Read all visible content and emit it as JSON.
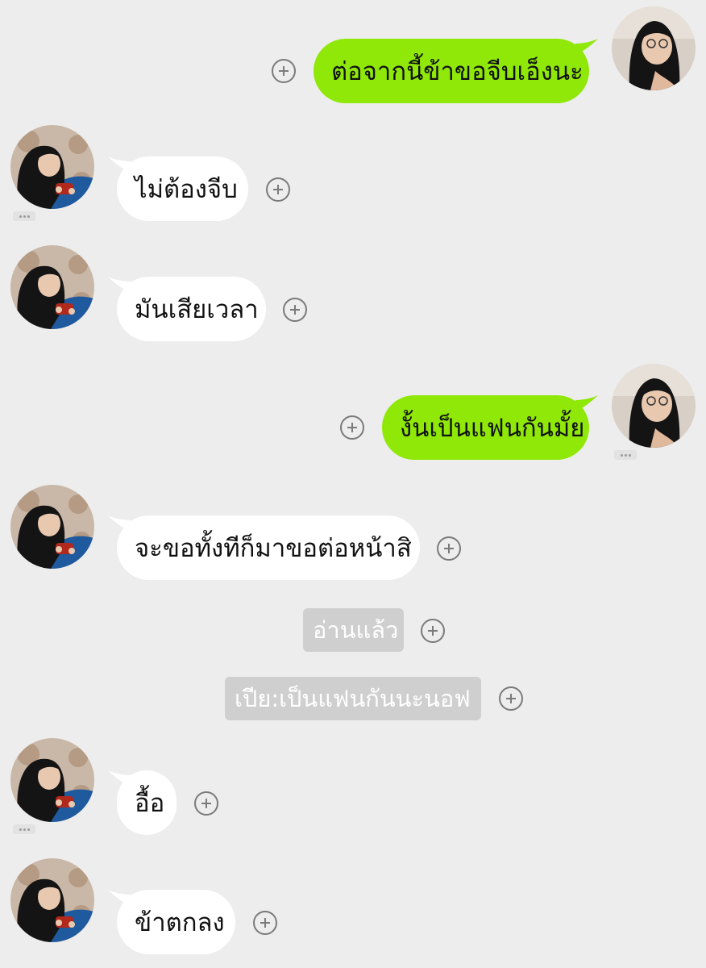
{
  "messages": [
    {
      "sender": "me",
      "text": "ต่อจากนี้ข้าขอจีบเอ็งนะ"
    },
    {
      "sender": "them",
      "text": "ไม่ต้องจีบ"
    },
    {
      "sender": "them",
      "text": "มันเสียเวลา"
    },
    {
      "sender": "me",
      "text": "งั้นเป็นแฟนกันมั้ย"
    },
    {
      "sender": "them",
      "text": "จะขอทั้งทีก็มาขอต่อหน้าสิ"
    },
    {
      "sender": "system",
      "text": "อ่านแล้ว"
    },
    {
      "sender": "system",
      "text": "เปีย:เป็นแฟนกันนะนอฟ"
    },
    {
      "sender": "them",
      "text": "อื้อ"
    },
    {
      "sender": "them",
      "text": "ข้าตกลง"
    }
  ],
  "colors": {
    "background": "#ededed",
    "outgoing_bubble": "#8fe807",
    "incoming_bubble": "#ffffff",
    "system_bubble": "#cfcfcf"
  },
  "icons": {
    "add": "plus-circle-icon",
    "more": "ellipsis-icon"
  }
}
